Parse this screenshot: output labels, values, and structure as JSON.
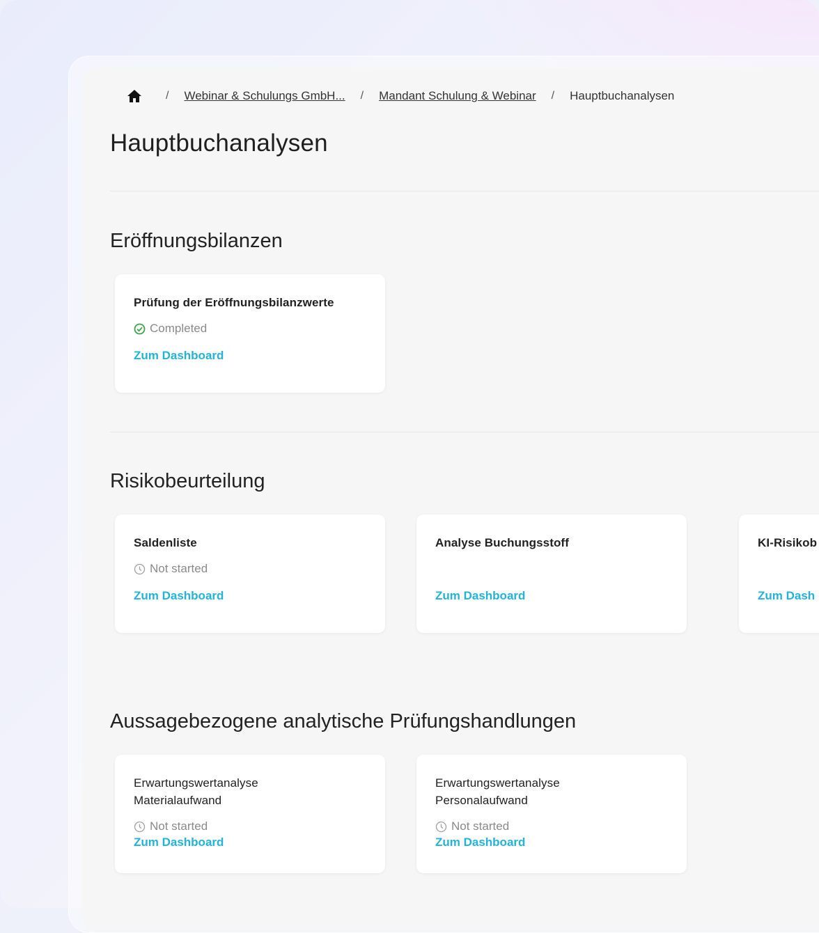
{
  "breadcrumb": {
    "home_icon": "home-icon",
    "separator": "/",
    "items": [
      {
        "label": "Webinar & Schulungs GmbH..."
      },
      {
        "label": "Mandant Schulung & Webinar"
      },
      {
        "label": "Hauptbuchanalysen"
      }
    ]
  },
  "page_title": "Hauptbuchanalysen",
  "sections": [
    {
      "title": "Eröffnungsbilanzen",
      "cards": [
        {
          "title": "Prüfung der Eröffnungsbilanzwerte",
          "status": "Completed",
          "status_icon": "check-circle-icon",
          "link": "Zum Dashboard"
        }
      ]
    },
    {
      "title": "Risikobeurteilung",
      "cards": [
        {
          "title": "Saldenliste",
          "status": "Not started",
          "status_icon": "clock-icon",
          "link": "Zum Dashboard"
        },
        {
          "title": "Analyse Buchungsstoff",
          "status": "",
          "link": "Zum Dashboard"
        },
        {
          "title": "KI-Risikob",
          "status": "",
          "link": "Zum Dash"
        }
      ]
    },
    {
      "title": "Aussagebezogene analytische Prüfungshandlungen",
      "cards": [
        {
          "title_line1": "Erwartungswertanalyse",
          "title_line2": "Materialaufwand",
          "status": "Not started",
          "status_icon": "clock-icon",
          "link": "Zum Dashboard"
        },
        {
          "title_line1": "Erwartungswertanalyse",
          "title_line2": "Personalaufwand",
          "status": "Not started",
          "status_icon": "clock-icon",
          "link": "Zum Dashboard"
        }
      ]
    }
  ],
  "colors": {
    "link": "#22b3d9",
    "completed": "#3aa54a",
    "muted": "#8a8a8a",
    "panel": "#f6f6f6",
    "card": "#ffffff"
  }
}
